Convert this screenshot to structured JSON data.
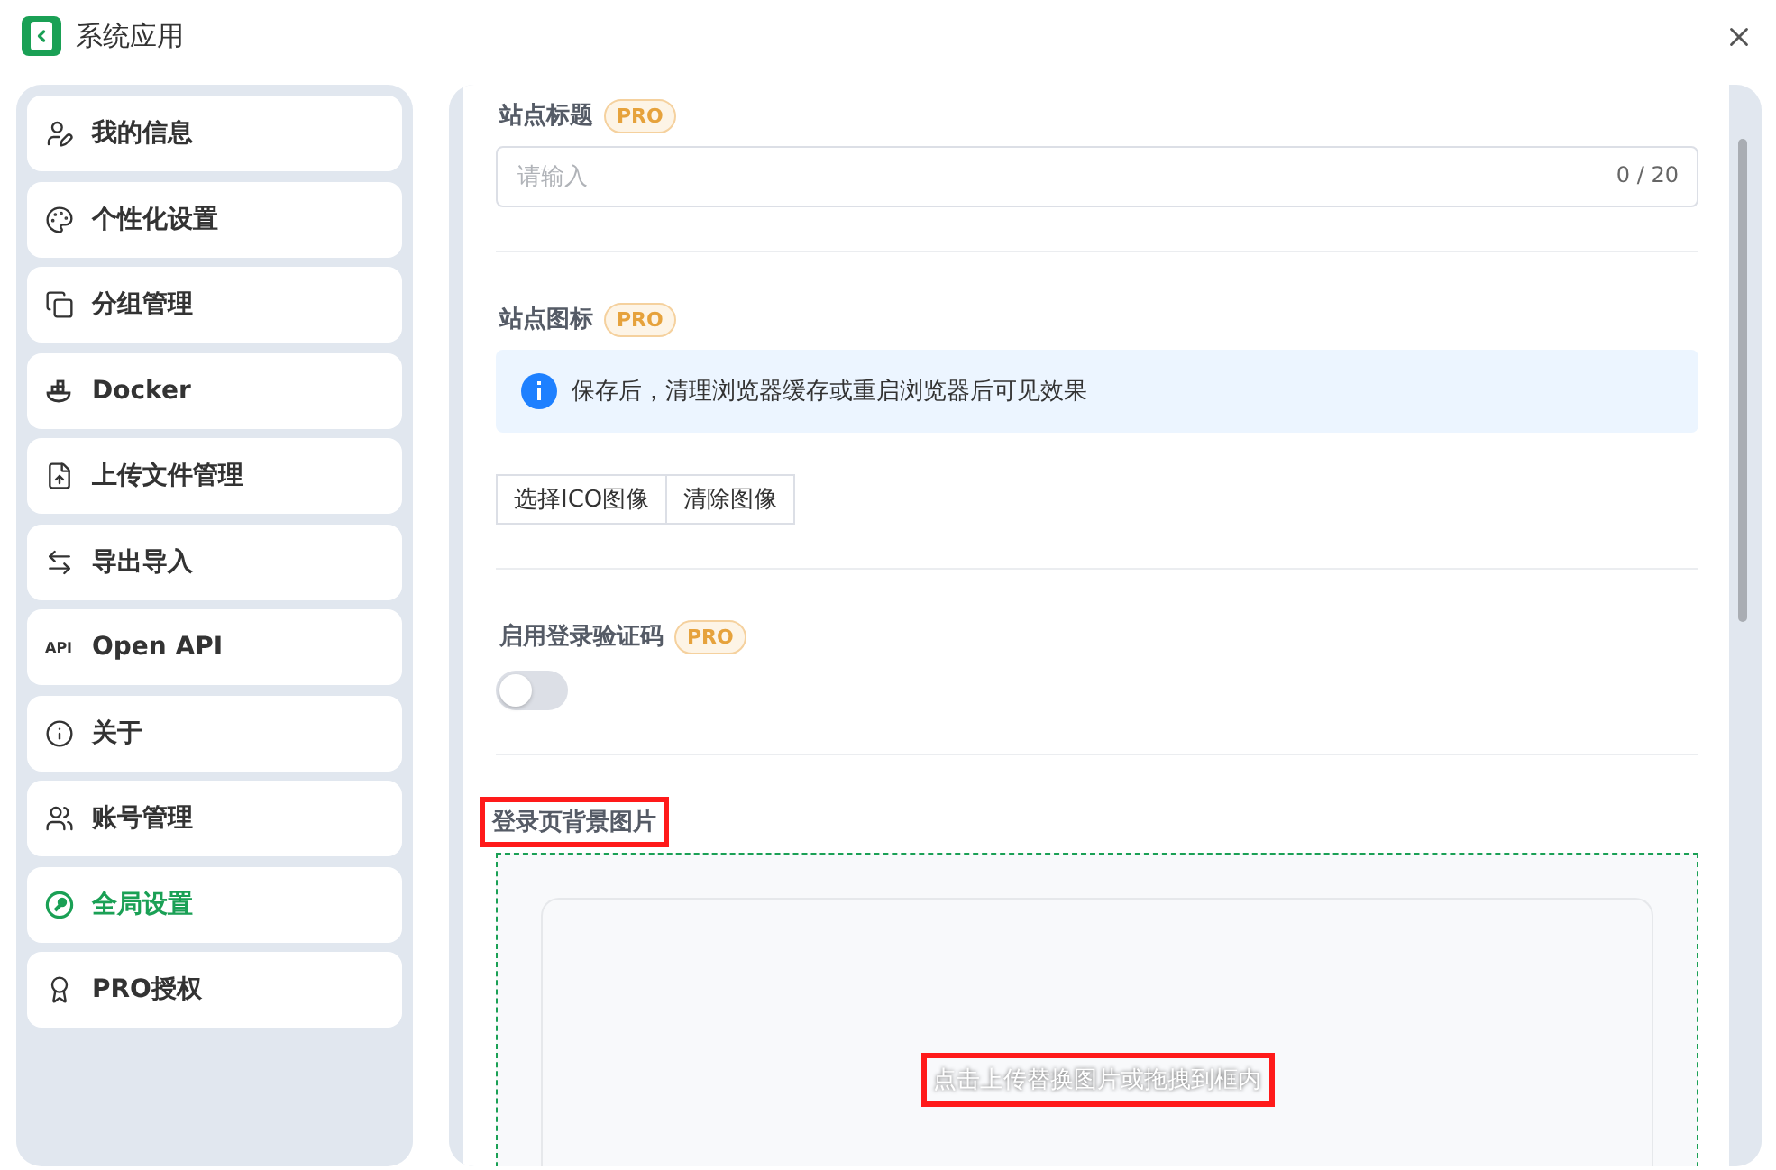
{
  "window": {
    "title": "系统应用"
  },
  "sidebar": {
    "items": [
      {
        "label": "我的信息",
        "selected": false
      },
      {
        "label": "个性化设置",
        "selected": false
      },
      {
        "label": "分组管理",
        "selected": false
      },
      {
        "label": "Docker",
        "selected": false
      },
      {
        "label": "上传文件管理",
        "selected": false
      },
      {
        "label": "导出导入",
        "selected": false
      },
      {
        "label": "Open API",
        "icon_text": "API",
        "selected": false
      },
      {
        "label": "关于",
        "selected": false
      },
      {
        "label": "账号管理",
        "selected": false
      },
      {
        "label": "全局设置",
        "selected": true
      },
      {
        "label": "PRO授权",
        "selected": false
      }
    ]
  },
  "settings": {
    "site_title": {
      "label": "站点标题",
      "badge": "PRO",
      "placeholder": "请输入",
      "counter": "0 / 20"
    },
    "site_icon": {
      "label": "站点图标",
      "badge": "PRO",
      "notice": "保存后，清理浏览器缓存或重启浏览器后可见效果",
      "buttons": [
        "选择ICO图像",
        "清除图像"
      ]
    },
    "login_captcha": {
      "label": "启用登录验证码",
      "badge": "PRO",
      "on": false
    },
    "login_background": {
      "label": "登录页背景图片",
      "highlighted": true,
      "upload_hint": "点击上传替换图片或拖拽到框内",
      "hint_highlighted": true
    }
  }
}
